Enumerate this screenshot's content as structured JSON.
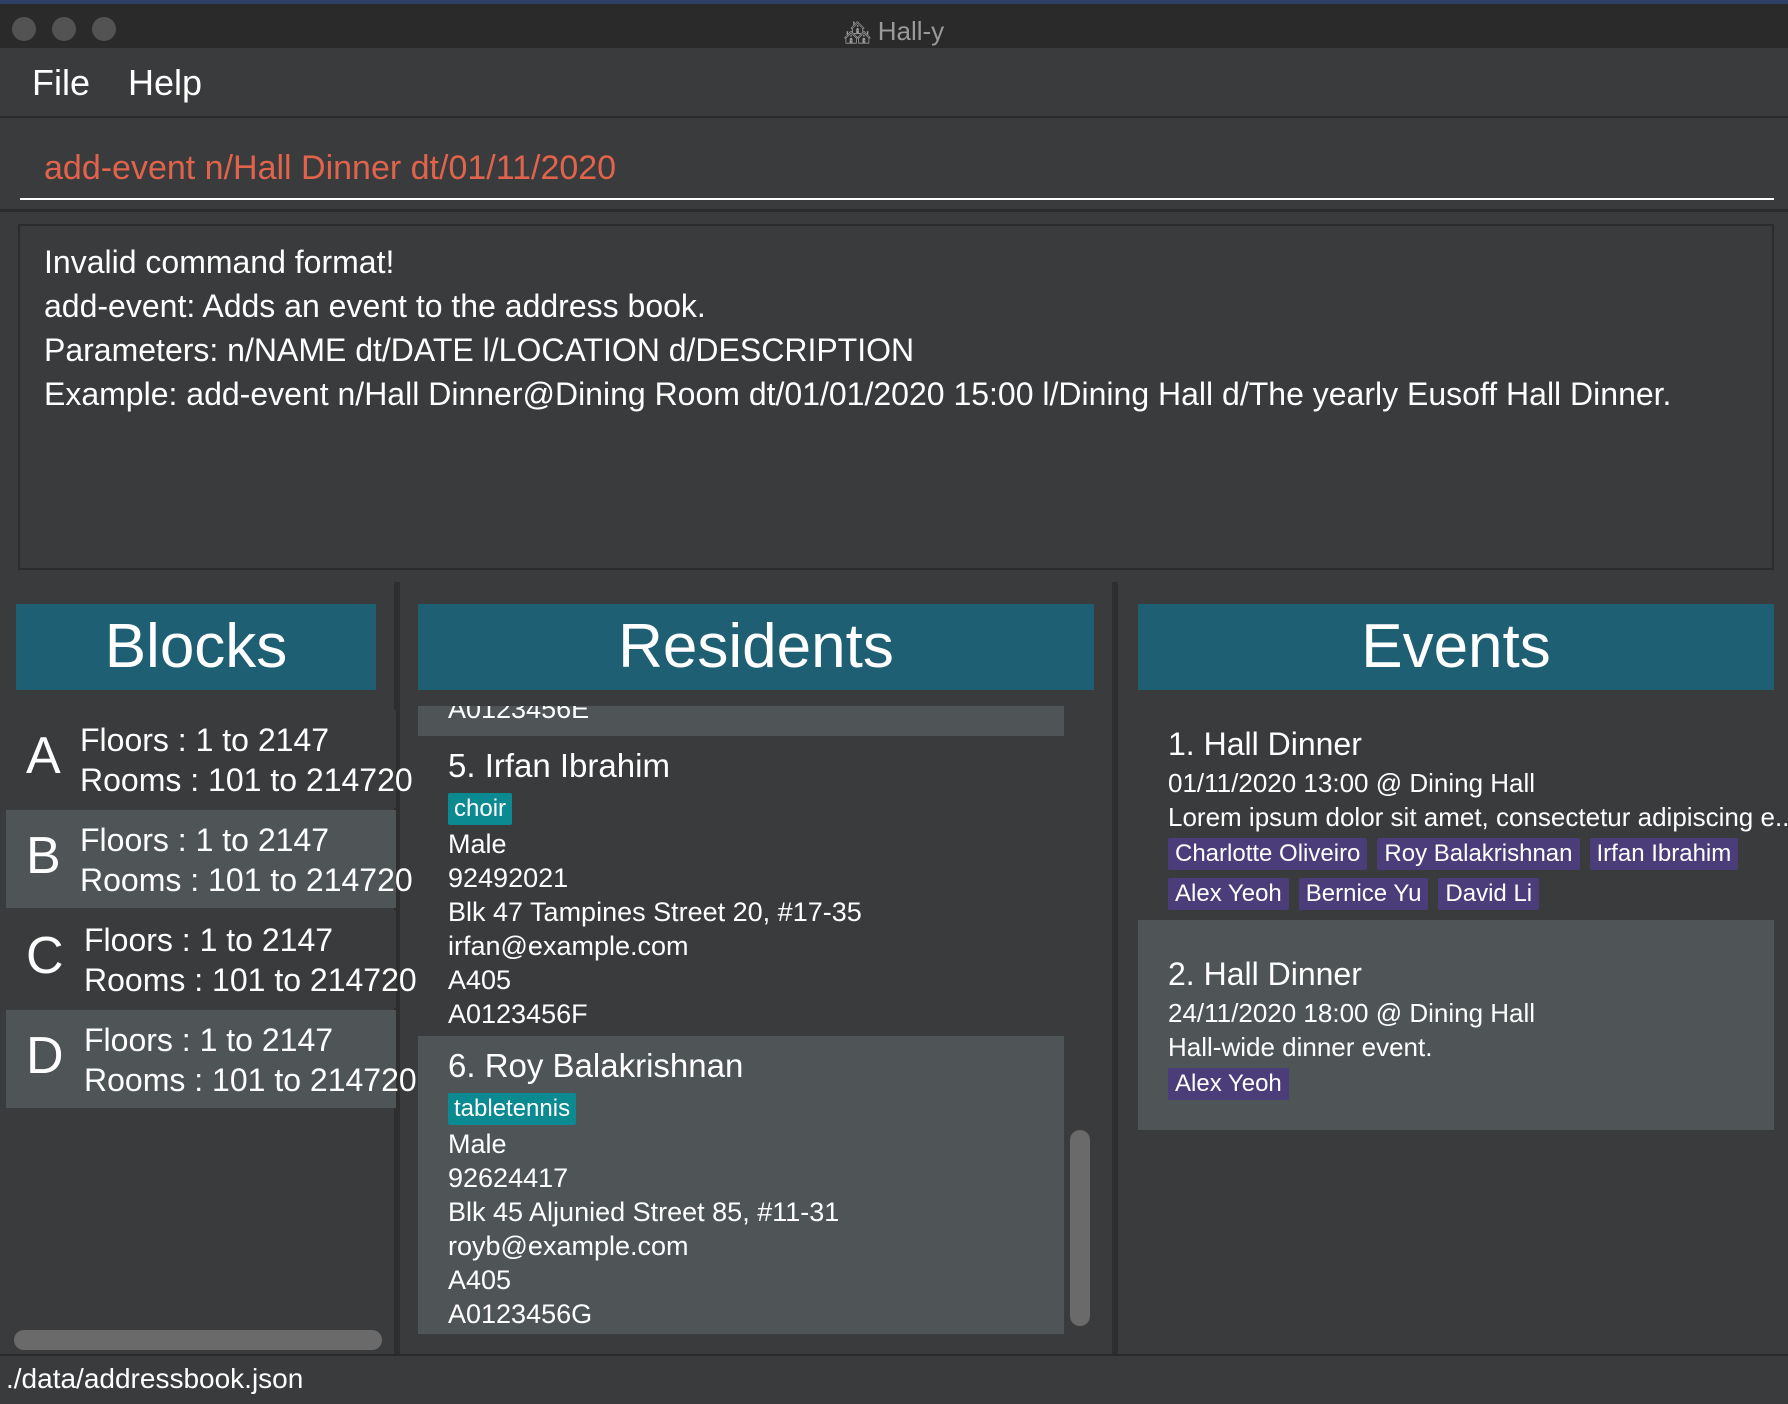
{
  "window": {
    "title": "Hall-y",
    "title_icon": "house-icon"
  },
  "menu": {
    "file": "File",
    "help": "Help"
  },
  "command": {
    "value": "add-event n/Hall Dinner dt/01/11/2020",
    "color": "#e2634b"
  },
  "result": {
    "lines": [
      "Invalid command format!",
      "add-event: Adds an event to the address book.",
      "Parameters: n/NAME dt/DATE l/LOCATION d/DESCRIPTION",
      "Example: add-event n/Hall Dinner@Dining Room dt/01/01/2020 15:00 l/Dining Hall d/The yearly Eusoff Hall Dinner."
    ]
  },
  "blocks": {
    "title": "Blocks",
    "items": [
      {
        "letter": "A",
        "floors": "Floors : 1 to 2147",
        "rooms": "Rooms : 101 to 214720"
      },
      {
        "letter": "B",
        "floors": "Floors : 1 to 2147",
        "rooms": "Rooms : 101 to 214720"
      },
      {
        "letter": "C",
        "floors": "Floors : 1 to 2147",
        "rooms": "Rooms : 101 to 214720"
      },
      {
        "letter": "D",
        "floors": "Floors : 1 to 2147",
        "rooms": "Rooms : 101 to 214720"
      }
    ]
  },
  "residents": {
    "title": "Residents",
    "partial_above": "A0123456E",
    "items": [
      {
        "heading": "5.  Irfan Ibrahim",
        "tag": "choir",
        "gender": "Male",
        "phone": "92492021",
        "address": "Blk 47 Tampines Street 20, #17-35",
        "email": "irfan@example.com",
        "room": "A405",
        "matric": "A0123456F"
      },
      {
        "heading": "6.  Roy Balakrishnan",
        "tag": "tabletennis",
        "gender": "Male",
        "phone": "92624417",
        "address": "Blk 45 Aljunied Street 85, #11-31",
        "email": "royb@example.com",
        "room": "A405",
        "matric": "A0123456G"
      }
    ]
  },
  "events": {
    "title": "Events",
    "items": [
      {
        "heading": "1.  Hall Dinner",
        "when": "01/11/2020 13:00 @ Dining Hall",
        "description": "Lorem ipsum dolor sit amet, consectetur adipiscing e...",
        "attendees": [
          "Charlotte Oliveiro",
          "Roy Balakrishnan",
          "Irfan Ibrahim",
          "Alex Yeoh",
          "Bernice Yu",
          "David Li"
        ]
      },
      {
        "heading": "2.  Hall Dinner",
        "when": "24/11/2020 18:00 @ Dining Hall",
        "description": "Hall-wide dinner event.",
        "attendees": [
          "Alex Yeoh"
        ]
      }
    ]
  },
  "status": {
    "path": "./data/addressbook.json"
  },
  "colors": {
    "panel_header": "#1f5f73",
    "resident_tag": "#0b8a91",
    "event_tag": "#4b3d7a",
    "card_light": "#4f5457",
    "card_dark": "#3a3b3c"
  }
}
